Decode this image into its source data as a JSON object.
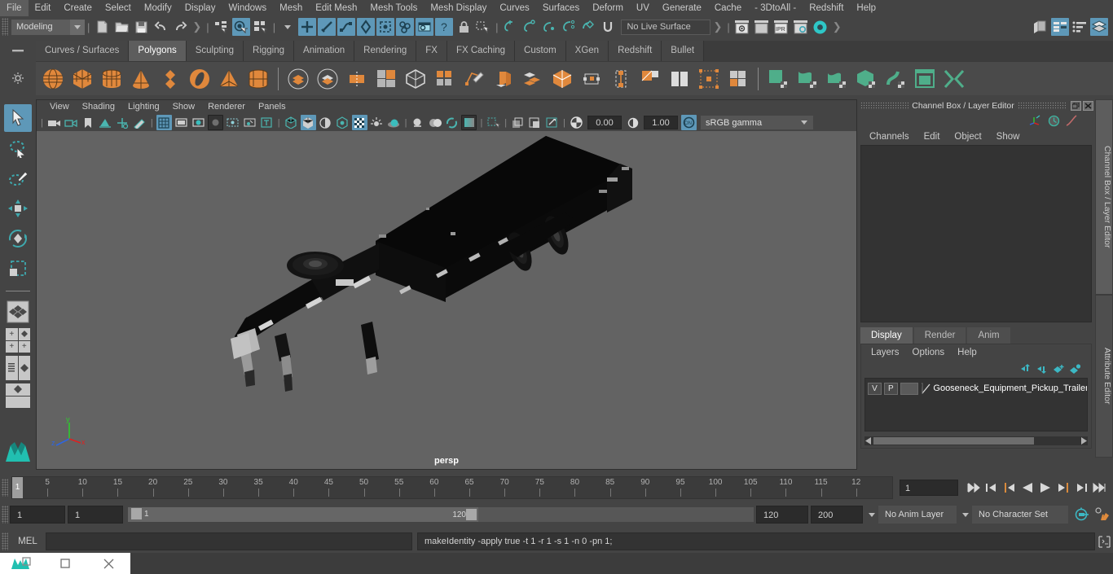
{
  "menubar": {
    "items": [
      "File",
      "Edit",
      "Create",
      "Select",
      "Modify",
      "Display",
      "Windows",
      "Mesh",
      "Edit Mesh",
      "Mesh Tools",
      "Mesh Display",
      "Curves",
      "Surfaces",
      "Deform",
      "UV",
      "Generate",
      "Cache",
      "- 3DtoAll -",
      "Redshift",
      "Help"
    ]
  },
  "statusbar": {
    "mode": "Modeling",
    "live_surface": "No Live Surface",
    "icons": [
      "new-scene-icon",
      "open-scene-icon",
      "save-scene-icon",
      "undo-icon",
      "redo-icon",
      "select-hierarchy-icon",
      "select-object-icon",
      "select-component-icon",
      "snap-grid-icon",
      "snap-curve-icon",
      "snap-point-icon",
      "snap-projected-icon",
      "snap-view-plane-icon",
      "make-live-icon",
      "construction-history-icon",
      "lock-icon",
      "select-by-name-icon",
      "render-current-frame-icon",
      "render-sequence-icon",
      "ipr-render-icon",
      "render-settings-icon",
      "hypershade-icon",
      "show-hide-editor-icon",
      "attribute-editor-icon",
      "tool-settings-icon",
      "channel-box-icon",
      "modeling-toolkit-icon"
    ]
  },
  "shelf": {
    "tabs": [
      "Curves / Surfaces",
      "Polygons",
      "Sculpting",
      "Rigging",
      "Animation",
      "Rendering",
      "FX",
      "FX Caching",
      "Custom",
      "XGen",
      "Redshift",
      "Bullet"
    ],
    "selected_tab": "Polygons",
    "icons": [
      "poly-sphere-icon",
      "poly-cube-icon",
      "poly-cylinder-icon",
      "poly-cone-icon",
      "poly-plane-icon",
      "poly-torus-icon",
      "poly-pyramid-icon",
      "poly-prism-icon",
      "boolean-union-icon",
      "boolean-difference-icon",
      "boolean-intersection-icon",
      "combine-icon",
      "separate-icon",
      "smooth-icon",
      "extrude-icon",
      "bevel-icon",
      "bridge-icon",
      "append-polygon-icon",
      "multicut-icon",
      "target-weld-icon",
      "quad-draw-icon",
      "mirror-icon",
      "reduce-icon",
      "crease-icon",
      "sculpt-icon",
      "sculpt-grab-icon",
      "sculpt-smooth-icon",
      "sculpt-relax-icon",
      "sculpt-pinch-icon",
      "sculpt-flatten-icon",
      "sculpt-foamy-icon",
      "sculpt-spray-icon"
    ]
  },
  "toolbox": {
    "tools": [
      "select-tool",
      "lasso-select-tool",
      "paint-select-tool",
      "move-tool",
      "rotate-tool",
      "scale-tool"
    ],
    "selected_tool": "select-tool",
    "layouts": [
      "single-perspective-layout",
      "four-view-layout",
      "outliner-persp-layout",
      "hypergraph-persp-layout",
      "persp-graph-layout"
    ]
  },
  "viewport": {
    "menus": [
      "View",
      "Shading",
      "Lighting",
      "Show",
      "Renderer",
      "Panels"
    ],
    "camera_label": "persp",
    "exposure": "0.00",
    "gamma_value": "1.00",
    "color_space": "sRGB gamma",
    "toolbar_icons": [
      "select-camera-icon",
      "camera-attributes-icon",
      "bookmark-icon",
      "image-plane-icon",
      "2d-pan-zoom-icon",
      "grease-pencil-icon",
      "grid-toggle-icon",
      "film-gate-icon",
      "resolution-gate-icon",
      "gate-mask-icon",
      "film-origin-icon",
      "exposure-icon",
      "xray-icon",
      "wireframe-shaded-icon",
      "smooth-shade-icon",
      "shaded-wireframe-icon",
      "hardware-texturing-icon",
      "use-all-lights-icon",
      "shadows-icon",
      "ambient-occlusion-icon",
      "motion-blur-icon",
      "isolate-select-icon",
      "xray-joints-icon",
      "xray-active-components-icon",
      "viewport-snapshot-icon",
      "exposure-control-icon",
      "gamma-control-icon",
      "color-management-icon"
    ],
    "axis_labels": {
      "x": "x",
      "y": "y",
      "z": "z"
    }
  },
  "channel_box": {
    "title": "Channel Box / Layer Editor",
    "window_buttons": [
      "restore-icon",
      "close-icon"
    ],
    "menus": [
      "Channels",
      "Edit",
      "Object",
      "Show"
    ],
    "tool_icons": [
      "transform-axis-icon",
      "anim-clock-icon",
      "graph-curve-icon"
    ],
    "vertical_tabs": [
      "Channel Box / Layer Editor",
      "Attribute Editor"
    ],
    "selected_vertical_tab": "Channel Box / Layer Editor"
  },
  "layer_editor": {
    "tabs": [
      "Display",
      "Render",
      "Anim"
    ],
    "selected_tab": "Display",
    "menus": [
      "Layers",
      "Options",
      "Help"
    ],
    "buttons": [
      "move-layer-up-icon",
      "move-layer-down-icon",
      "create-empty-layer-icon",
      "create-layer-from-selected-icon"
    ],
    "layers": [
      {
        "visible": "V",
        "playback": "P",
        "name": "Gooseneck_Equipment_Pickup_Trailer"
      }
    ]
  },
  "time_slider": {
    "current_frame": "1",
    "frame_field": "1",
    "tick_labels": [
      "5",
      "10",
      "15",
      "20",
      "25",
      "30",
      "35",
      "40",
      "45",
      "50",
      "55",
      "60",
      "65",
      "70",
      "75",
      "80",
      "85",
      "90",
      "95",
      "100",
      "105",
      "110",
      "115",
      "12"
    ],
    "playback_buttons": [
      "go-to-start-icon",
      "step-back-keyframe-icon",
      "step-back-frame-icon",
      "play-backwards-icon",
      "play-forwards-icon",
      "step-forward-frame-icon",
      "step-forward-keyframe-icon",
      "go-to-end-icon"
    ]
  },
  "range_slider": {
    "anim_start": "1",
    "range_start": "1",
    "range_bar_value": "1",
    "range_end_handle": "120",
    "range_end": "120",
    "anim_end": "200",
    "anim_layer": "No Anim Layer",
    "character_set": "No Character Set",
    "right_icons": [
      "auto-keyframe-icon",
      "animation-preferences-icon"
    ]
  },
  "command_line": {
    "label": "MEL",
    "input_value": "",
    "output": "makeIdentity -apply true -t 1 -r 1 -s 1 -n 0 -pn 1;",
    "script-editor-icon": "script-editor-icon"
  },
  "taskbar": {
    "items": [
      "maya-app-icon",
      "restore-window-icon",
      "minimize-window-icon",
      "close-window-icon"
    ]
  },
  "colors": {
    "accent_blue": "#5e98b8",
    "accent_teal": "#4ab5b0",
    "shelf_orange": "#e08b3c",
    "shelf_green": "#4fae8a",
    "panel_bg": "#444444",
    "viewport_bg": "#636363"
  }
}
